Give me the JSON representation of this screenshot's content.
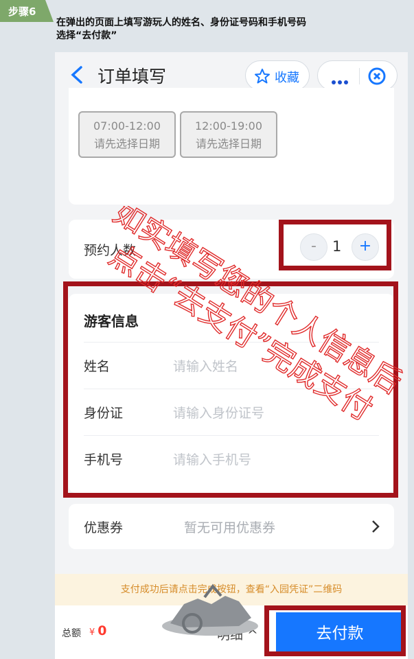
{
  "step": {
    "badge": "步骤6",
    "line1": "在弹出的页面上填写游玩人的姓名、身份证号码和手机号码",
    "line2": "选择“去付款”"
  },
  "navbar": {
    "title": "订单填写",
    "favorite_label": "收藏"
  },
  "time_slots": [
    {
      "time": "07:00-12:00",
      "hint": "请先选择日期"
    },
    {
      "time": "12:00-19:00",
      "hint": "请先选择日期"
    }
  ],
  "booking": {
    "label": "预约人数",
    "minus": "-",
    "count": "1",
    "plus": "+"
  },
  "visitor": {
    "title": "游客信息",
    "fields": [
      {
        "label": "姓名",
        "placeholder": "请输入姓名"
      },
      {
        "label": "身份证",
        "placeholder": "请输入身份证号"
      },
      {
        "label": "手机号",
        "placeholder": "请输入手机号"
      }
    ]
  },
  "coupon": {
    "label": "优惠券",
    "value": "暂无可用优惠券"
  },
  "notice": "支付成功后请点击完成按钮，查看“入园凭证”二维码",
  "footer": {
    "total_label": "总额",
    "currency": "¥",
    "total": "0",
    "detail": "明细 ^",
    "pay": "去付款"
  },
  "annotation": {
    "line1": "如实填写您的个人信息后",
    "line2": "点击“去支付”完成支付"
  },
  "colors": {
    "accent": "#1677ff",
    "annotation_red": "#a3131b",
    "step_green": "#7ea86a"
  }
}
